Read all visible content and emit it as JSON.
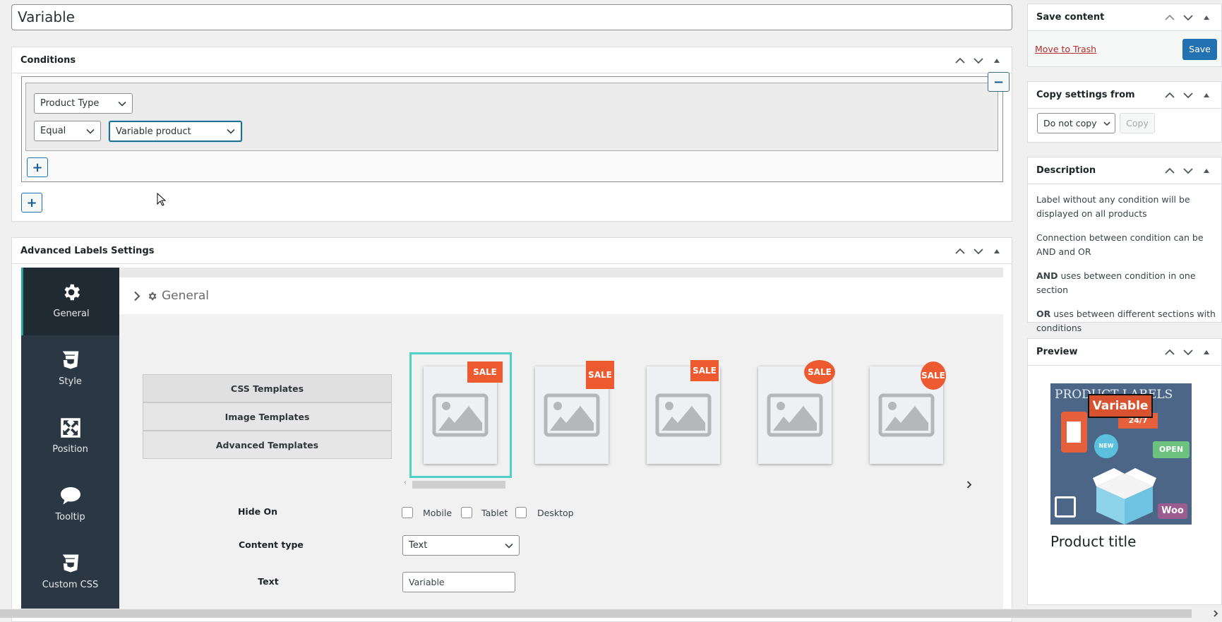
{
  "title_input": {
    "value": "Variable"
  },
  "conditions": {
    "title": "Conditions",
    "field_select": "Product Type",
    "operator_select": "Equal",
    "value_select": "Variable product",
    "add_and_label": "+",
    "add_or_label": "+",
    "remove_label": "−"
  },
  "advanced": {
    "title": "Advanced Labels Settings",
    "tabs": [
      {
        "label": "General",
        "icon": "gear-icon"
      },
      {
        "label": "Style",
        "icon": "css3-icon"
      },
      {
        "label": "Position",
        "icon": "arrows-expand-icon"
      },
      {
        "label": "Tooltip",
        "icon": "speech-bubble-icon"
      },
      {
        "label": "Custom CSS",
        "icon": "css3-icon"
      }
    ],
    "section_title": "General",
    "template_buttons": [
      "CSS Templates",
      "Image Templates",
      "Advanced Templates"
    ],
    "templates": [
      {
        "badge": "SALE",
        "shape": "square",
        "selected": true
      },
      {
        "badge": "SALE",
        "shape": "square-corner",
        "selected": false
      },
      {
        "badge": "SALE",
        "shape": "square-top",
        "selected": false
      },
      {
        "badge": "SALE",
        "shape": "circle-top",
        "selected": false
      },
      {
        "badge": "SALE",
        "shape": "circle-corner",
        "selected": false
      }
    ],
    "hide_on": {
      "label": "Hide On",
      "options": [
        "Mobile",
        "Tablet",
        "Desktop"
      ]
    },
    "content_type": {
      "label": "Content type",
      "value": "Text"
    },
    "text": {
      "label": "Text",
      "value": "Variable"
    }
  },
  "save_box": {
    "title": "Save content",
    "trash_label": "Move to Trash",
    "save_label": "Save"
  },
  "copy_box": {
    "title": "Copy settings from",
    "select_value": "Do not copy",
    "copy_label": "Copy"
  },
  "description": {
    "title": "Description",
    "p1": "Label without any condition will be displayed on all products",
    "p2": "Connection between condition can be AND and OR",
    "p3_bold": "AND",
    "p3_rest": " uses between condition in one section",
    "p4_bold": "OR",
    "p4_rest": " uses between different sections with conditions"
  },
  "preview": {
    "title": "Preview",
    "image_header": "PRODUCT LABELS",
    "badge_text": "Variable",
    "product_title": "Product title",
    "stickers": [
      "24/7",
      "NEW",
      "OPEN",
      "Woo"
    ]
  },
  "colors": {
    "accent": "#2271b1",
    "sale": "#ee5a2f",
    "selected_border": "#4fd1c5",
    "sidebar": "#2b3844"
  }
}
